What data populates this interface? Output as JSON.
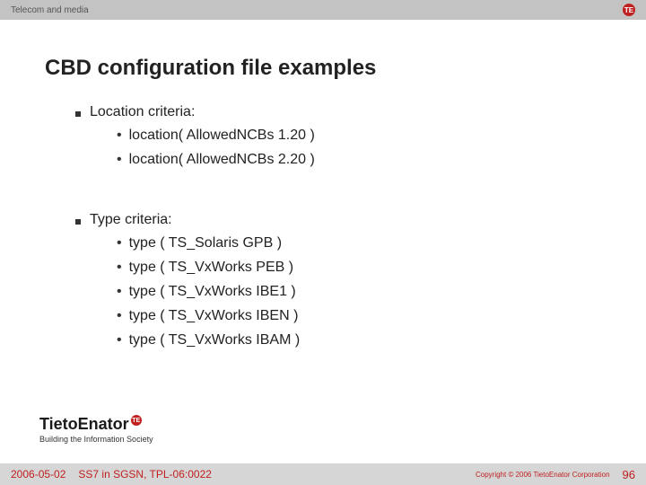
{
  "topbar": {
    "label": "Telecom and media",
    "icon_text": "TE"
  },
  "title": "CBD configuration file examples",
  "sections": [
    {
      "label": "Location criteria:",
      "items": [
        "location( AllowedNCBs 1.20 )",
        "location( AllowedNCBs 2.20 )"
      ]
    },
    {
      "label": "Type criteria:",
      "items": [
        "type ( TS_Solaris GPB )",
        "type ( TS_VxWorks PEB )",
        "type ( TS_VxWorks IBE1 )",
        "type ( TS_VxWorks IBEN )",
        "type ( TS_VxWorks IBAM )"
      ]
    }
  ],
  "brand": {
    "name": "TietoEnator",
    "icon_text": "TE",
    "tagline": "Building the Information Society"
  },
  "footer": {
    "date": "2006-05-02",
    "reference": "SS7 in SGSN, TPL-06:0022",
    "copyright": "Copyright © 2006 TietoEnator Corporation",
    "page": "96"
  }
}
